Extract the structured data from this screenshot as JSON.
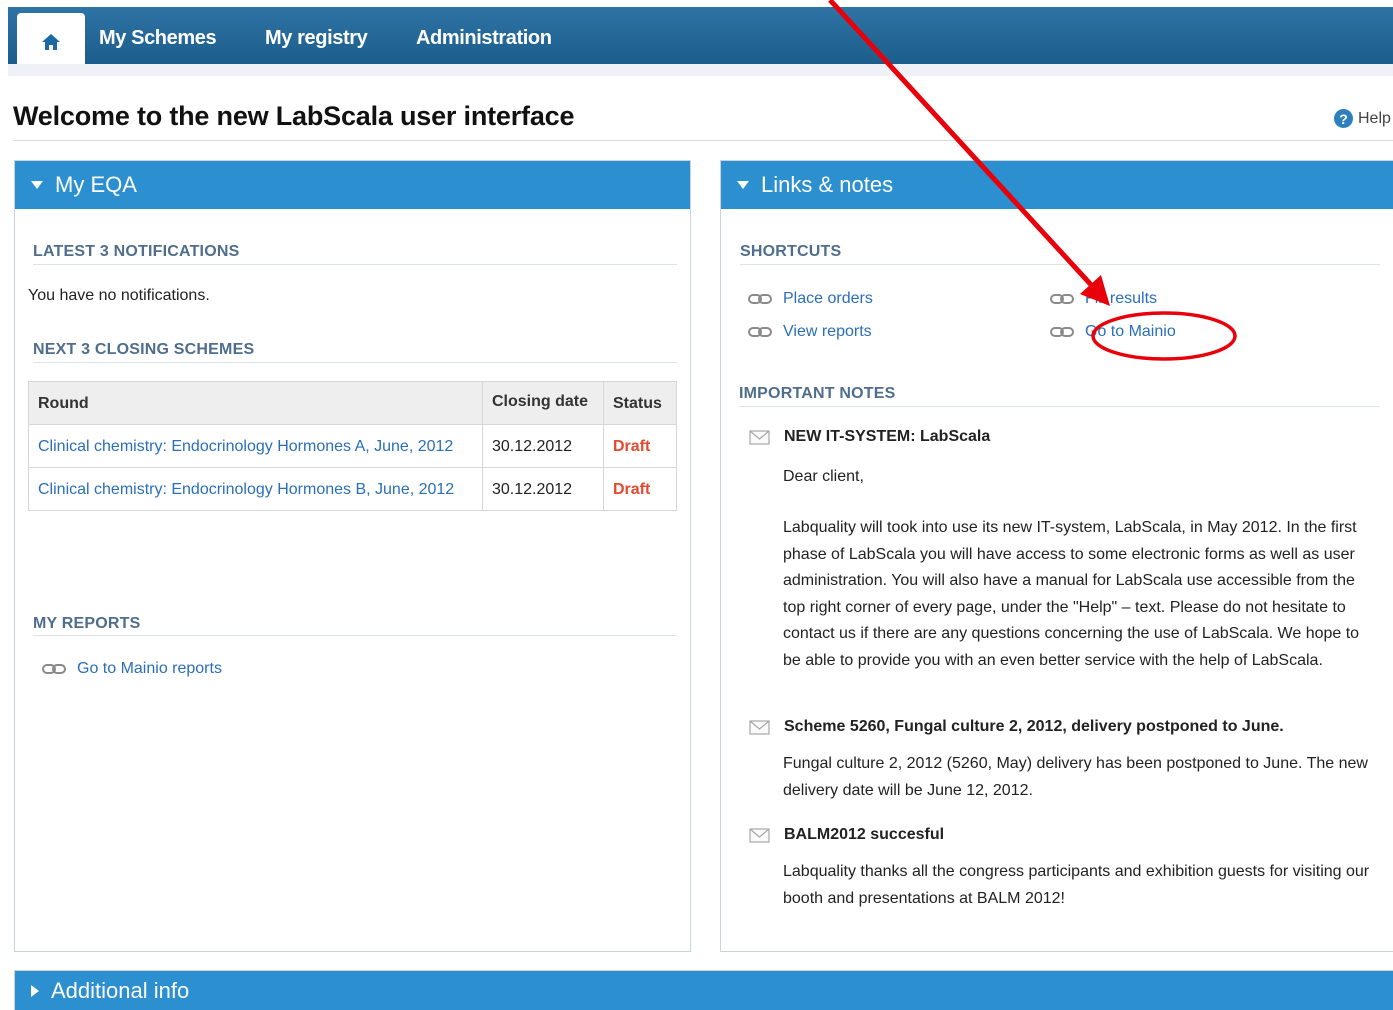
{
  "nav": {
    "home_icon": "home-icon",
    "items": [
      "My Schemes",
      "My registry",
      "Administration"
    ]
  },
  "page": {
    "title": "Welcome to the new LabScala user interface",
    "help_label": "Help",
    "help_icon": "question-icon"
  },
  "my_eqa": {
    "header": "My EQA",
    "notifications_title": "LATEST 3 NOTIFICATIONS",
    "notifications_text": "You have no notifications.",
    "closing_title": "NEXT 3 CLOSING SCHEMES",
    "table": {
      "headers": [
        "Round",
        "Closing date",
        "Status"
      ],
      "rows": [
        {
          "round": "Clinical chemistry: Endocrinology Hormones A, June, 2012",
          "closing_date": "30.12.2012",
          "status": "Draft"
        },
        {
          "round": "Clinical chemistry: Endocrinology Hormones B, June, 2012",
          "closing_date": "30.12.2012",
          "status": "Draft"
        }
      ]
    },
    "reports_title": "MY REPORTS",
    "reports_link": "Go to Mainio reports"
  },
  "links_notes": {
    "header": "Links & notes",
    "shortcuts_title": "SHORTCUTS",
    "shortcuts": [
      "Place orders",
      "View reports",
      "Fill results",
      "Go to Mainio"
    ],
    "notes_title": "IMPORTANT NOTES",
    "notes": [
      {
        "title": "NEW IT-SYSTEM: LabScala",
        "greeting": "Dear client,",
        "body": "Labquality will took into use its new IT-system, LabScala, in May 2012. In the first phase of LabScala you will have access to some electronic forms as well as user administration. You will also have a manual for LabScala use accessible from the top right corner of every page, under the \"Help\" – text. Please do not hesitate to contact us if there are any questions concerning the use of LabScala. We hope to be able to provide you with an even better service with the help of LabScala."
      },
      {
        "title": "Scheme 5260, Fungal culture 2, 2012, delivery postponed to June.",
        "body": "Fungal culture 2, 2012 (5260, May) delivery has been postponed to June. The new delivery date will be June 12, 2012."
      },
      {
        "title": "BALM2012 succesful",
        "body": "Labquality thanks all the congress participants and exhibition guests for visiting our booth and presentations at BALM 2012!"
      }
    ]
  },
  "additional_info": {
    "header": "Additional info"
  },
  "colors": {
    "nav_bg": "#1c5d8c",
    "panel_header": "#2b8fd0",
    "link": "#2a6fb8",
    "draft": "#e2492f",
    "annotation": "#e8000b"
  }
}
